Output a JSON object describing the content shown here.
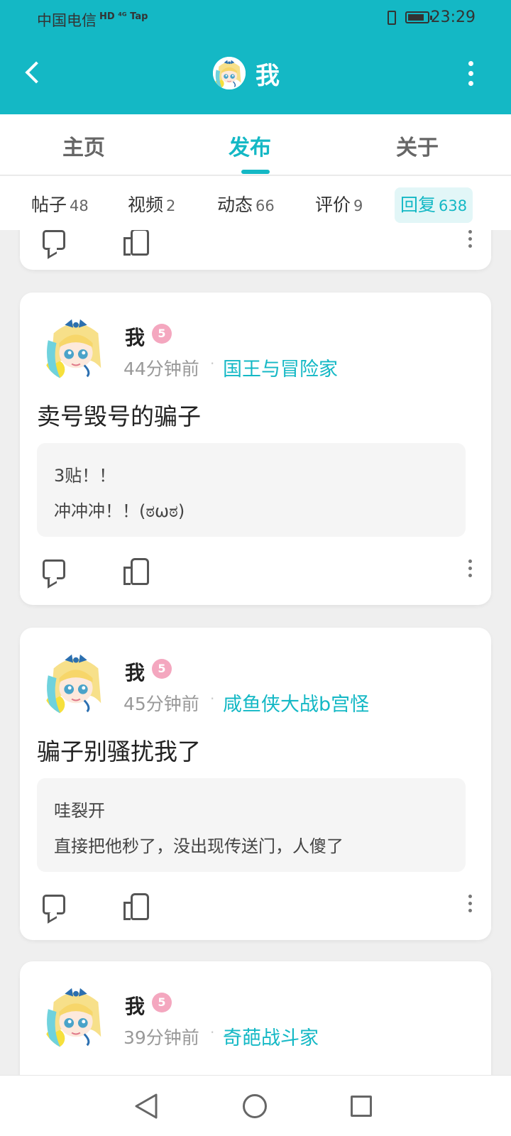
{
  "status_bar": {
    "carrier": "中国电信",
    "carrier_extra": "HD ⁴ᴳ Tap",
    "time": "23:29"
  },
  "nav": {
    "title": "我"
  },
  "tabs": [
    {
      "label": "主页"
    },
    {
      "label": "发布"
    },
    {
      "label": "关于"
    }
  ],
  "subtabs": [
    {
      "label": "帖子",
      "count": "48"
    },
    {
      "label": "视频",
      "count": "2"
    },
    {
      "label": "动态",
      "count": "66"
    },
    {
      "label": "评价",
      "count": "9"
    },
    {
      "label": "回复",
      "count": "638"
    }
  ],
  "posts": [
    {
      "user": "我",
      "level": "5",
      "time": "44分钟前",
      "game": "国王与冒险家",
      "title": "卖号毁号的骗子",
      "quote_line1": "3贴！！",
      "quote_line2": "冲冲冲！！(ಠωಠ)"
    },
    {
      "user": "我",
      "level": "5",
      "time": "45分钟前",
      "game": "咸鱼侠大战b宫怪",
      "title": "骗子别骚扰我了",
      "quote_line1": "哇裂开",
      "quote_line2": "直接把他秒了，没出现传送门，人傻了"
    },
    {
      "user": "我",
      "level": "5",
      "time": "39分钟前",
      "game": "奇葩战斗家"
    }
  ],
  "colors": {
    "brand": "#14b8c5",
    "level_badge": "#f4a7bf"
  },
  "icons": [
    "back-arrow-icon",
    "more-vertical-icon",
    "comment-icon",
    "like-icon",
    "nav-back-icon",
    "nav-home-icon",
    "nav-recent-icon"
  ]
}
